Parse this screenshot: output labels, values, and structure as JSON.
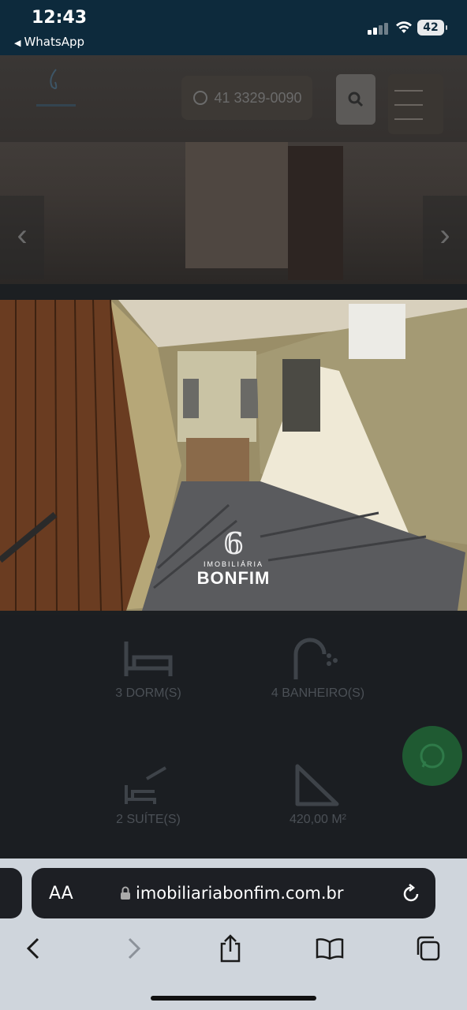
{
  "status_bar": {
    "time": "12:43",
    "back_app": "WhatsApp",
    "battery": "42"
  },
  "site_header": {
    "phone": "41 3329-0090"
  },
  "photo_watermark": {
    "small": "IMOBILIÁRIA",
    "big": "BONFIM"
  },
  "features": [
    {
      "label": "3 DORM(S)",
      "icon": "bed-icon"
    },
    {
      "label": "4 BANHEIRO(S)",
      "icon": "shower-icon"
    },
    {
      "label": "2 SUÍTE(S)",
      "icon": "suite-icon"
    },
    {
      "label": "420,00 M²",
      "icon": "area-triangle-icon"
    }
  ],
  "browser": {
    "aa_label": "AA",
    "url": "imobiliariabonfim.com.br"
  }
}
